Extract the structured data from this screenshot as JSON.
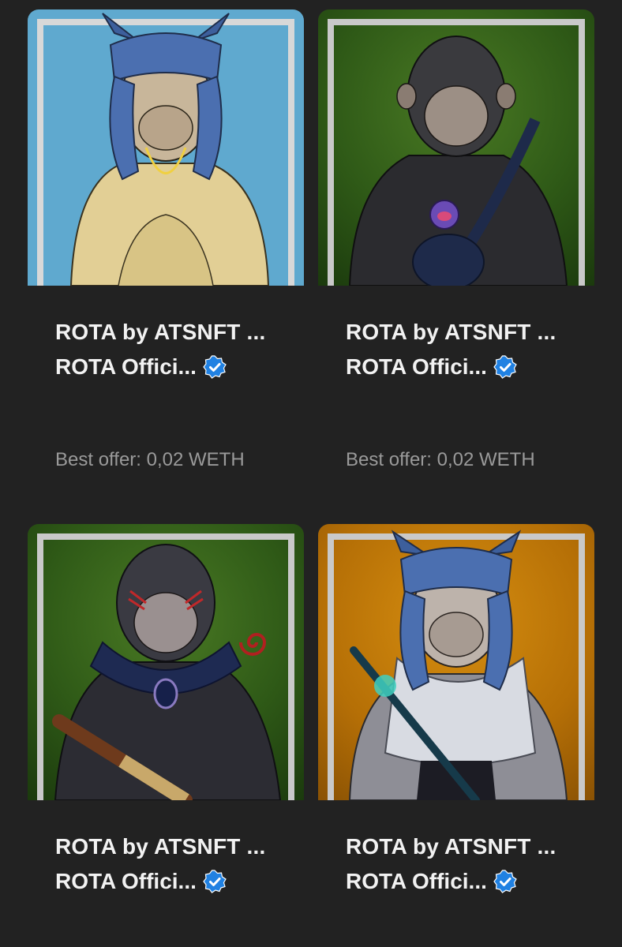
{
  "colors": {
    "background": "#222222",
    "text_primary": "#f2f2f2",
    "text_secondary": "#9a9a9a",
    "verified_blue": "#2081e2"
  },
  "cards": [
    {
      "title": "ROTA by ATSNFT ...",
      "collection": "ROTA Offici...",
      "verified_icon": "verified-badge-icon",
      "offer": "Best offer: 0,02 WETH",
      "art_background": "#5fa9cf"
    },
    {
      "title": "ROTA by ATSNFT ...",
      "collection": "ROTA Offici...",
      "verified_icon": "verified-badge-icon",
      "offer": "Best offer: 0,02 WETH",
      "art_background": "#2f5a17"
    },
    {
      "title": "ROTA by ATSNFT ...",
      "collection": "ROTA Offici...",
      "verified_icon": "verified-badge-icon",
      "art_background": "#2f5a17"
    },
    {
      "title": "ROTA by ATSNFT ...",
      "collection": "ROTA Offici...",
      "verified_icon": "verified-badge-icon",
      "art_background": "#b56f06"
    }
  ]
}
